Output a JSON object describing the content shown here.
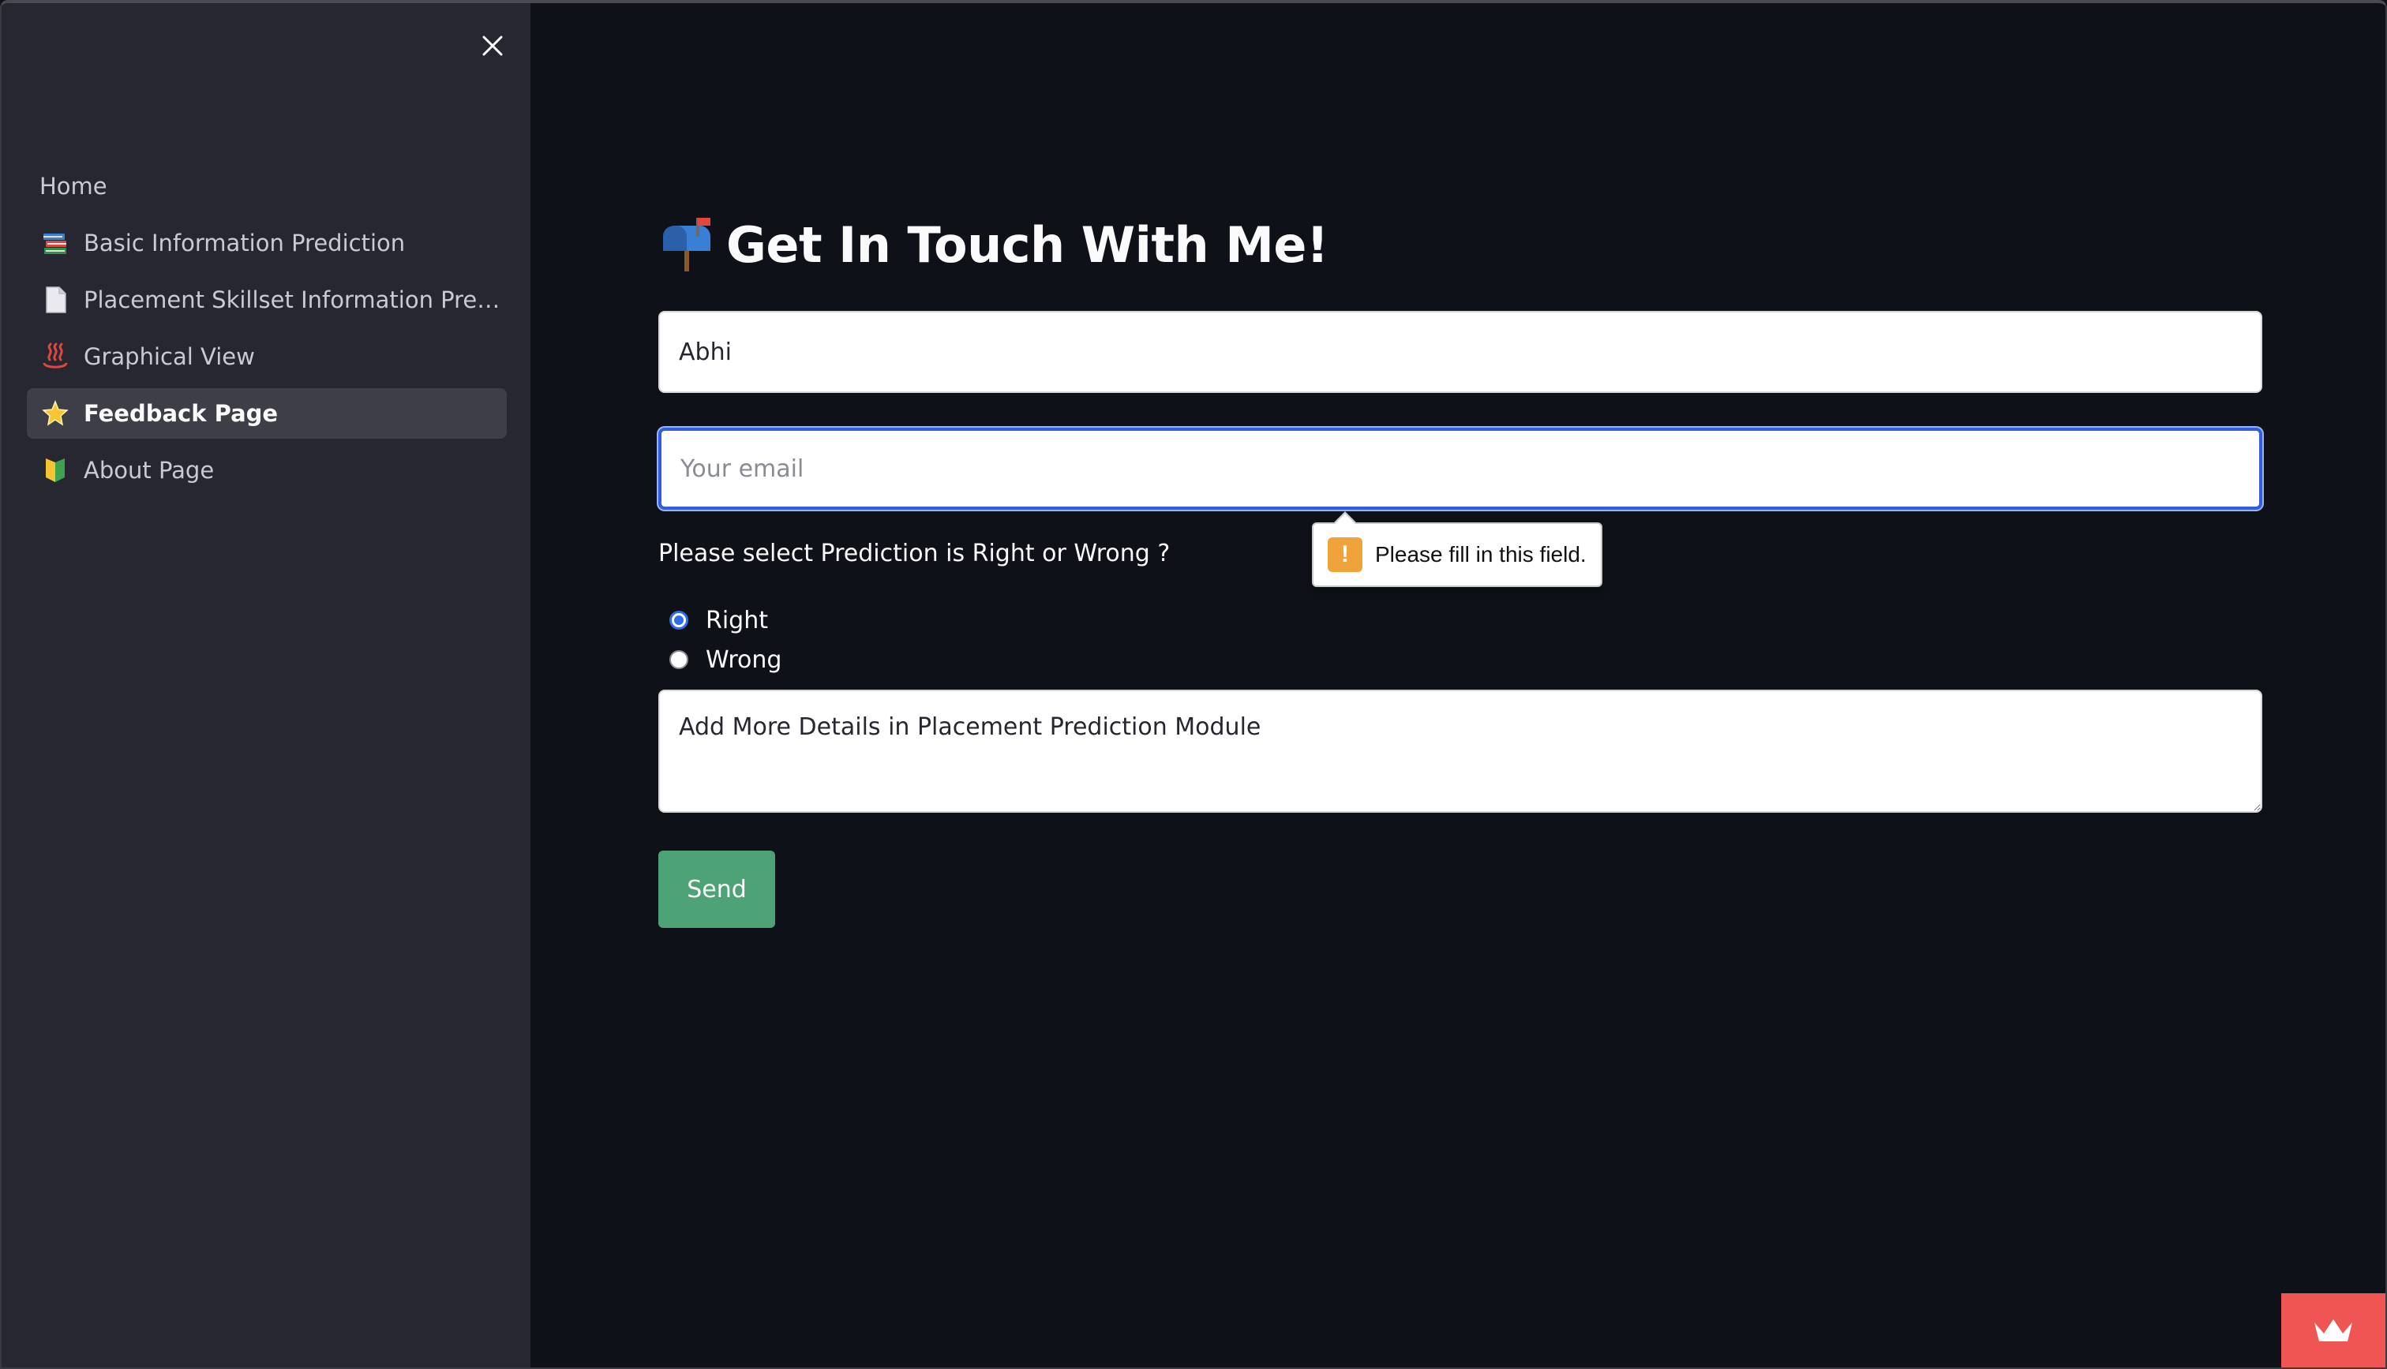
{
  "sidebar": {
    "close_label": "×",
    "items": [
      {
        "label": "Home",
        "icon": ""
      },
      {
        "label": "Basic Information Prediction",
        "icon": "books-icon"
      },
      {
        "label": "Placement Skillset Information Predi…",
        "icon": "page-icon"
      },
      {
        "label": "Graphical View",
        "icon": "hot-springs-icon"
      },
      {
        "label": "Feedback Page",
        "icon": "glowing-star-icon",
        "active": true
      },
      {
        "label": "About Page",
        "icon": "beginner-icon"
      }
    ]
  },
  "main": {
    "title": "Get In Touch With Me!",
    "title_icon": "mailbox-icon",
    "name_value": "Abhi",
    "email_placeholder": "Your email",
    "validation_message": "Please fill in this field.",
    "question": "Please select Prediction is Right or Wrong ?",
    "radio_options": [
      {
        "label": "Right",
        "checked": true
      },
      {
        "label": "Wrong",
        "checked": false
      }
    ],
    "message_value": "Add More Details in Placement Prediction Module",
    "send_label": "Send"
  },
  "colors": {
    "background": "#0e1117",
    "sidebar": "#262730",
    "send_button": "#4da375",
    "focus_border": "#2f5fe0",
    "badge": "#ef5552"
  }
}
